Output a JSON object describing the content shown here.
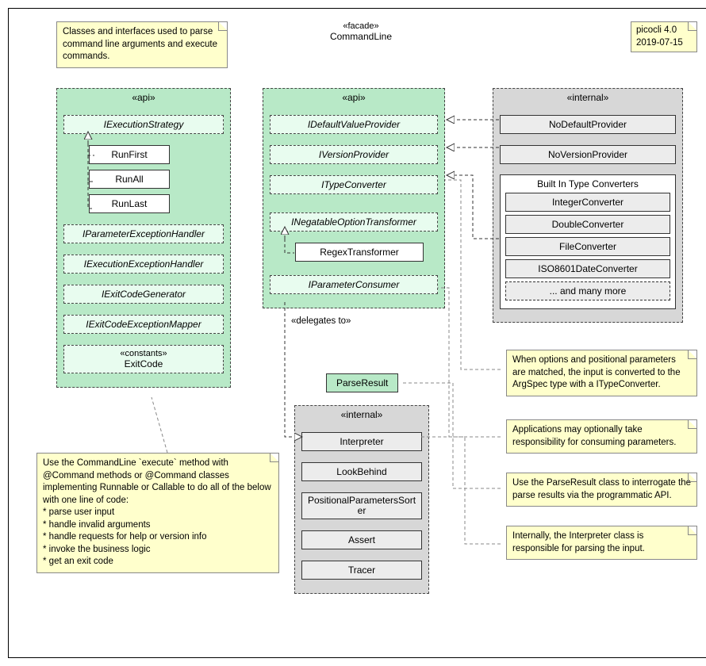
{
  "header": {
    "stereo": "«facade»",
    "title": "CommandLine",
    "version": "picocli 4.0",
    "date": "2019-07-15"
  },
  "notes": {
    "intro": "Classes and interfaces used to parse command line arguments and execute commands.",
    "execute": "Use the CommandLine `execute` method with @Command methods or @Command classes implementing Runnable or Callable to do all of the below with one line of code:\n* parse user input\n* handle invalid arguments\n* handle requests for help or version info\n* invoke the business logic\n* get an exit code",
    "typeconv": "When options and positional parameters are matched, the input is converted to the ArgSpec type with a ITypeConverter.",
    "paramconsumer": "Applications may optionally take responsibility for consuming parameters.",
    "parseresult": "Use the ParseResult class to interrogate the parse results via the programmatic API.",
    "interpreter": "Internally, the Interpreter class is responsible for parsing the input."
  },
  "api1": {
    "label": "«api»",
    "istrategy": "IExecutionStrategy",
    "runfirst": "RunFirst",
    "runall": "RunAll",
    "runlast": "RunLast",
    "iparamex": "IParameterExceptionHandler",
    "iexecex": "IExecutionExceptionHandler",
    "iexitgen": "IExitCodeGenerator",
    "iexitmap": "IExitCodeExceptionMapper",
    "constants_stereo": "«constants»",
    "exitcode": "ExitCode"
  },
  "api2": {
    "label": "«api»",
    "idefault": "IDefaultValueProvider",
    "iversion": "IVersionProvider",
    "itype": "ITypeConverter",
    "inegatable": "INegatableOptionTransformer",
    "regex": "RegexTransformer",
    "iparamc": "IParameterConsumer"
  },
  "delegates": "«delegates to»",
  "parseresult": "ParseResult",
  "internal2": {
    "label": "«internal»",
    "interpreter": "Interpreter",
    "lookbehind": "LookBehind",
    "possorter": "PositionalParametersSorter",
    "assert": "Assert",
    "tracer": "Tracer"
  },
  "internal1": {
    "label": "«internal»",
    "nodefault": "NoDefaultProvider",
    "noversion": "NoVersionProvider",
    "group_title": "Built In Type Converters",
    "intconv": "IntegerConverter",
    "dblconv": "DoubleConverter",
    "fileconv": "FileConverter",
    "isoconv": "ISO8601DateConverter",
    "more": "... and many more"
  },
  "chart_data": {
    "type": "uml-class-diagram",
    "title": "CommandLine «facade»",
    "packages": [
      {
        "name": "api",
        "color": "green",
        "elements": [
          "IExecutionStrategy",
          "RunFirst",
          "RunAll",
          "RunLast",
          "IParameterExceptionHandler",
          "IExecutionExceptionHandler",
          "IExitCodeGenerator",
          "IExitCodeExceptionMapper",
          "ExitCode «constants»"
        ]
      },
      {
        "name": "api",
        "color": "green",
        "elements": [
          "IDefaultValueProvider",
          "IVersionProvider",
          "ITypeConverter",
          "INegatableOptionTransformer",
          "RegexTransformer",
          "IParameterConsumer"
        ]
      },
      {
        "name": "internal",
        "color": "gray",
        "elements": [
          "NoDefaultProvider",
          "NoVersionProvider",
          "Built In Type Converters: IntegerConverter, DoubleConverter, FileConverter, ISO8601DateConverter, ... and many more"
        ]
      },
      {
        "name": "internal",
        "color": "gray",
        "elements": [
          "Interpreter",
          "LookBehind",
          "PositionalParametersSorter",
          "Assert",
          "Tracer"
        ]
      }
    ],
    "standalone": [
      "ParseResult"
    ],
    "relations": [
      {
        "from": "RunFirst",
        "to": "IExecutionStrategy",
        "type": "realization"
      },
      {
        "from": "RunAll",
        "to": "IExecutionStrategy",
        "type": "realization"
      },
      {
        "from": "RunLast",
        "to": "IExecutionStrategy",
        "type": "realization"
      },
      {
        "from": "RegexTransformer",
        "to": "INegatableOptionTransformer",
        "type": "realization"
      },
      {
        "from": "NoDefaultProvider",
        "to": "IDefaultValueProvider",
        "type": "realization"
      },
      {
        "from": "NoVersionProvider",
        "to": "IVersionProvider",
        "type": "realization"
      },
      {
        "from": "BuiltInTypeConverters",
        "to": "ITypeConverter",
        "type": "realization"
      },
      {
        "from": "IParameterConsumer",
        "to": "Interpreter",
        "type": "dependency",
        "label": "delegates to"
      }
    ]
  }
}
